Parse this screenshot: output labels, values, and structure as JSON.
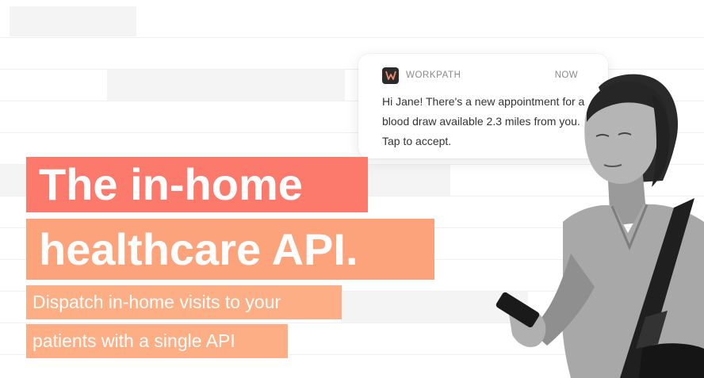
{
  "notification": {
    "app_name": "WORKPATH",
    "time": "NOW",
    "message": "Hi Jane! There's a new appointment for a blood draw available 2.3 miles from you. Tap to accept.",
    "icon": "workpath-logo-icon"
  },
  "hero": {
    "headline_line1": "The in-home",
    "headline_line2": "healthcare API.",
    "subtitle_line1": "Dispatch in-home visits to your",
    "subtitle_line2": "patients with a single API"
  },
  "colors": {
    "headline_1_bg": "#fc7a6b",
    "headline_2_bg": "#fda37b",
    "subtitle_bg": "#fdae84",
    "app_icon_bg": "#2b2b2b"
  }
}
